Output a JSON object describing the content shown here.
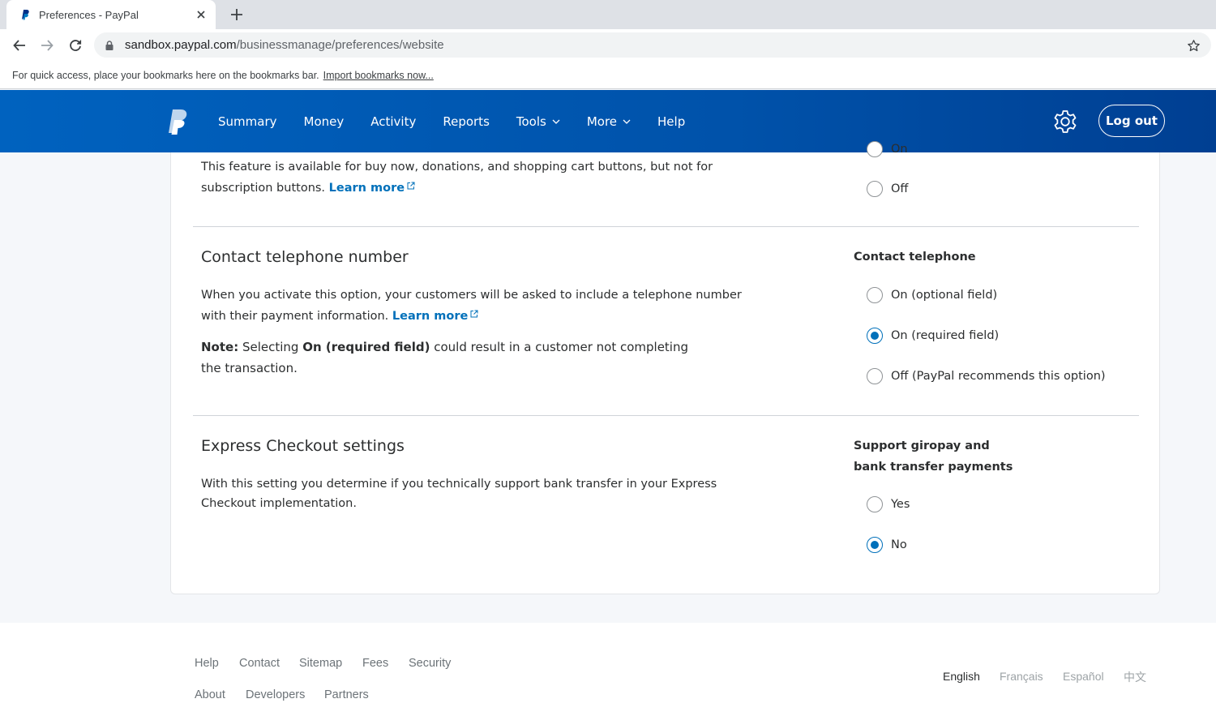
{
  "browser": {
    "tab_title": "Preferences - PayPal",
    "url_host": "sandbox.paypal.com",
    "url_path": "/businessmanage/preferences/website",
    "bookmarks_text": "For quick access, place your bookmarks here on the bookmarks bar.",
    "bookmarks_link": "Import bookmarks now..."
  },
  "header": {
    "nav": [
      "Summary",
      "Money",
      "Activity",
      "Reports",
      "Tools",
      "More",
      "Help"
    ],
    "logout_label": "Log out"
  },
  "sections": {
    "top": {
      "text": "This feature is available for buy now, donations, and shopping cart buttons, but not for subscription buttons.",
      "learn_more": "Learn more",
      "partial_option": "On",
      "off_option": "Off"
    },
    "telephone": {
      "title": "Contact telephone number",
      "description": "When you activate this option, your customers will be asked to include a telephone number with their payment information.",
      "learn_more": "Learn more",
      "note_label": "Note:",
      "note_pre": "Selecting",
      "note_bold": "On (required field)",
      "note_post": "could result in a customer not completing the transaction.",
      "option_title": "Contact telephone",
      "options": [
        "On (optional field)",
        "On (required field)",
        "Off (PayPal recommends this option)"
      ],
      "selected": "On (required field)"
    },
    "express": {
      "title": "Express Checkout settings",
      "description": "With this setting you determine if you technically support bank transfer in your Express Checkout implementation.",
      "option_title_line1": "Support giropay and",
      "option_title_line2": "bank transfer payments",
      "options": [
        "Yes",
        "No"
      ],
      "selected": "No"
    }
  },
  "footer": {
    "links_row1": [
      "Help",
      "Contact",
      "Sitemap",
      "Fees",
      "Security"
    ],
    "links_row2": [
      "About",
      "Developers",
      "Partners"
    ],
    "languages": [
      "English",
      "Français",
      "Español",
      "中文"
    ],
    "active_language": "English"
  },
  "colors": {
    "brand_blue": "#0062bf",
    "link_blue": "#0070ba"
  }
}
